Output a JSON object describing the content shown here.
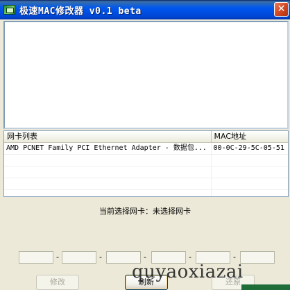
{
  "window": {
    "title": "极速MAC修改器 v0.1 beta",
    "close_glyph": "✕"
  },
  "adapter_list": {
    "columns": [
      "网卡列表",
      "MAC地址"
    ],
    "rows": [
      {
        "name": "AMD PCNET Family PCI Ethernet Adapter - 数据包...",
        "mac": "00-0C-29-5C-05-51"
      }
    ],
    "empty_rows": 5
  },
  "status": {
    "text": "当前选择网卡：未选择网卡"
  },
  "mac_fields": {
    "separator": "-",
    "values": [
      "",
      "",
      "",
      "",
      "",
      ""
    ]
  },
  "buttons": {
    "modify": "修改",
    "refresh": "刷新",
    "restore": "还原"
  },
  "watermark": {
    "text": "quyaoxiazai"
  },
  "colors": {
    "titlebar": "#0058ee",
    "background": "#ece9d8",
    "disabled_text": "#a7a69a",
    "border": "#7f9db9"
  }
}
